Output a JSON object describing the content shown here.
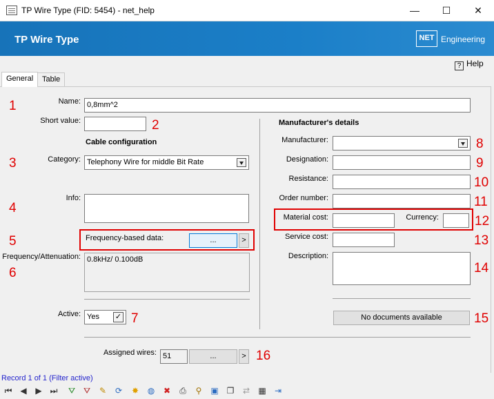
{
  "window": {
    "title": "TP Wire Type (FID: 5454) - net_help",
    "minimize": "—",
    "maximize": "☐",
    "close": "✕"
  },
  "header": {
    "title": "TP Wire Type",
    "logo": "NET",
    "logo_text": "Engineering"
  },
  "help": {
    "icon": "?",
    "label": "Help"
  },
  "tabs": [
    {
      "label": "General",
      "active": true
    },
    {
      "label": "Table",
      "active": false
    }
  ],
  "form": {
    "name_label": "Name:",
    "name_value": "0,8mm^2",
    "short_label": "Short value:",
    "short_value": "",
    "cable_config_title": "Cable configuration",
    "category_label": "Category:",
    "category_value": "Telephony Wire for middle Bit Rate",
    "info_label": "Info:",
    "info_value": "",
    "freq_label": "Frequency-based data:",
    "freq_button": "...",
    "freq_next": ">",
    "freq_att_label": "Frequency/Attenuation:",
    "freq_att_value": "0.8kHz/ 0.100dB",
    "active_label": "Active:",
    "active_value": "Yes",
    "active_check": "✓",
    "assigned_label": "Assigned wires:",
    "assigned_value": "51",
    "assigned_button": "...",
    "assigned_next": ">"
  },
  "manufacturer": {
    "title": "Manufacturer's details",
    "manufacturer_label": "Manufacturer:",
    "manufacturer_value": "",
    "designation_label": "Designation:",
    "designation_value": "",
    "resistance_label": "Resistance:",
    "resistance_value": "",
    "order_label": "Order number:",
    "order_value": "",
    "material_label": "Material cost:",
    "material_value": "",
    "currency_label": "Currency:",
    "currency_value": "",
    "service_label": "Service cost:",
    "service_value": "",
    "description_label": "Description:",
    "description_value": "",
    "documents_button": "No documents available"
  },
  "annotations": [
    "1",
    "2",
    "3",
    "4",
    "5",
    "6",
    "7",
    "8",
    "9",
    "10",
    "11",
    "12",
    "13",
    "14",
    "15",
    "16"
  ],
  "status": "Record 1 of 1 (Filter active)",
  "toolbar": {
    "first": "⏮",
    "prev": "◀",
    "next": "▶",
    "last": "⏭",
    "filter_add": "⛛",
    "filter_remove": "⛛",
    "edit": "✎",
    "refresh": "⟳",
    "new": "✸",
    "web": "◍",
    "delete": "✖",
    "print": "⎙",
    "zoom": "⚲",
    "select": "▣",
    "copy": "❐",
    "move": "⇄",
    "table": "▦",
    "exit": "⇥"
  },
  "colors": {
    "header_blue": "#1773b9",
    "annotation_red": "#e00000",
    "status_blue": "#2222cc"
  }
}
